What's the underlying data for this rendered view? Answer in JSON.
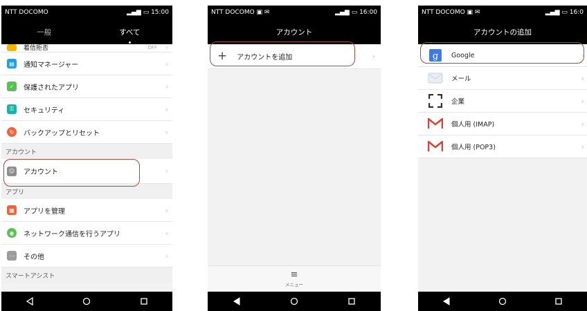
{
  "screen1": {
    "status": {
      "carrier": "NTT DOCOMO",
      "time": "15:00"
    },
    "tabs": [
      {
        "label": "一般"
      },
      {
        "label": "すべて"
      }
    ],
    "partial_row": {
      "label": "着信拒否",
      "value": "OFF"
    },
    "rows_top": [
      {
        "label": "通知マネージャー",
        "icon": "notification-manager-icon",
        "color": "#1fa0e0"
      },
      {
        "label": "保護されたアプリ",
        "icon": "protected-apps-icon",
        "color": "#5cbf54"
      },
      {
        "label": "セキュリティ",
        "icon": "security-icon",
        "color": "#19b3a6"
      },
      {
        "label": "バックアップとリセット",
        "icon": "backup-reset-icon",
        "color": "#f0643c"
      }
    ],
    "section_account": "アカウント",
    "account_row": {
      "label": "アカウント",
      "icon": "account-icon",
      "color": "#8d8d8d"
    },
    "section_apps": "アプリ",
    "rows_apps": [
      {
        "label": "アプリを管理",
        "icon": "manage-apps-icon",
        "color": "#f0643c"
      },
      {
        "label": "ネットワーク通信を行うアプリ",
        "icon": "network-apps-icon",
        "color": "#5cbf54"
      },
      {
        "label": "その他",
        "icon": "other-icon",
        "color": "#9c9c9c"
      }
    ],
    "section_assist": "スマートアシスト"
  },
  "screen2": {
    "status": {
      "carrier": "NTT DOCOMO",
      "time": "16:00"
    },
    "title": "アカウント",
    "add_account": "アカウントを追加",
    "menu_label": "メニュー"
  },
  "screen3": {
    "status": {
      "carrier": "NTT DOCOMO",
      "time": "16:0"
    },
    "title": "アカウントの追加",
    "accounts": [
      {
        "label": "Google",
        "icon": "google-icon"
      },
      {
        "label": "メール",
        "icon": "mail-icon"
      },
      {
        "label": "企業",
        "icon": "exchange-icon"
      },
      {
        "label": "個人用 (IMAP)",
        "icon": "gmail-icon"
      },
      {
        "label": "個人用 (POP3)",
        "icon": "gmail-icon"
      }
    ]
  },
  "colors": {
    "highlight": "#a64a3a",
    "google_blue": "#3d7be0",
    "gmail_red": "#d44638"
  }
}
